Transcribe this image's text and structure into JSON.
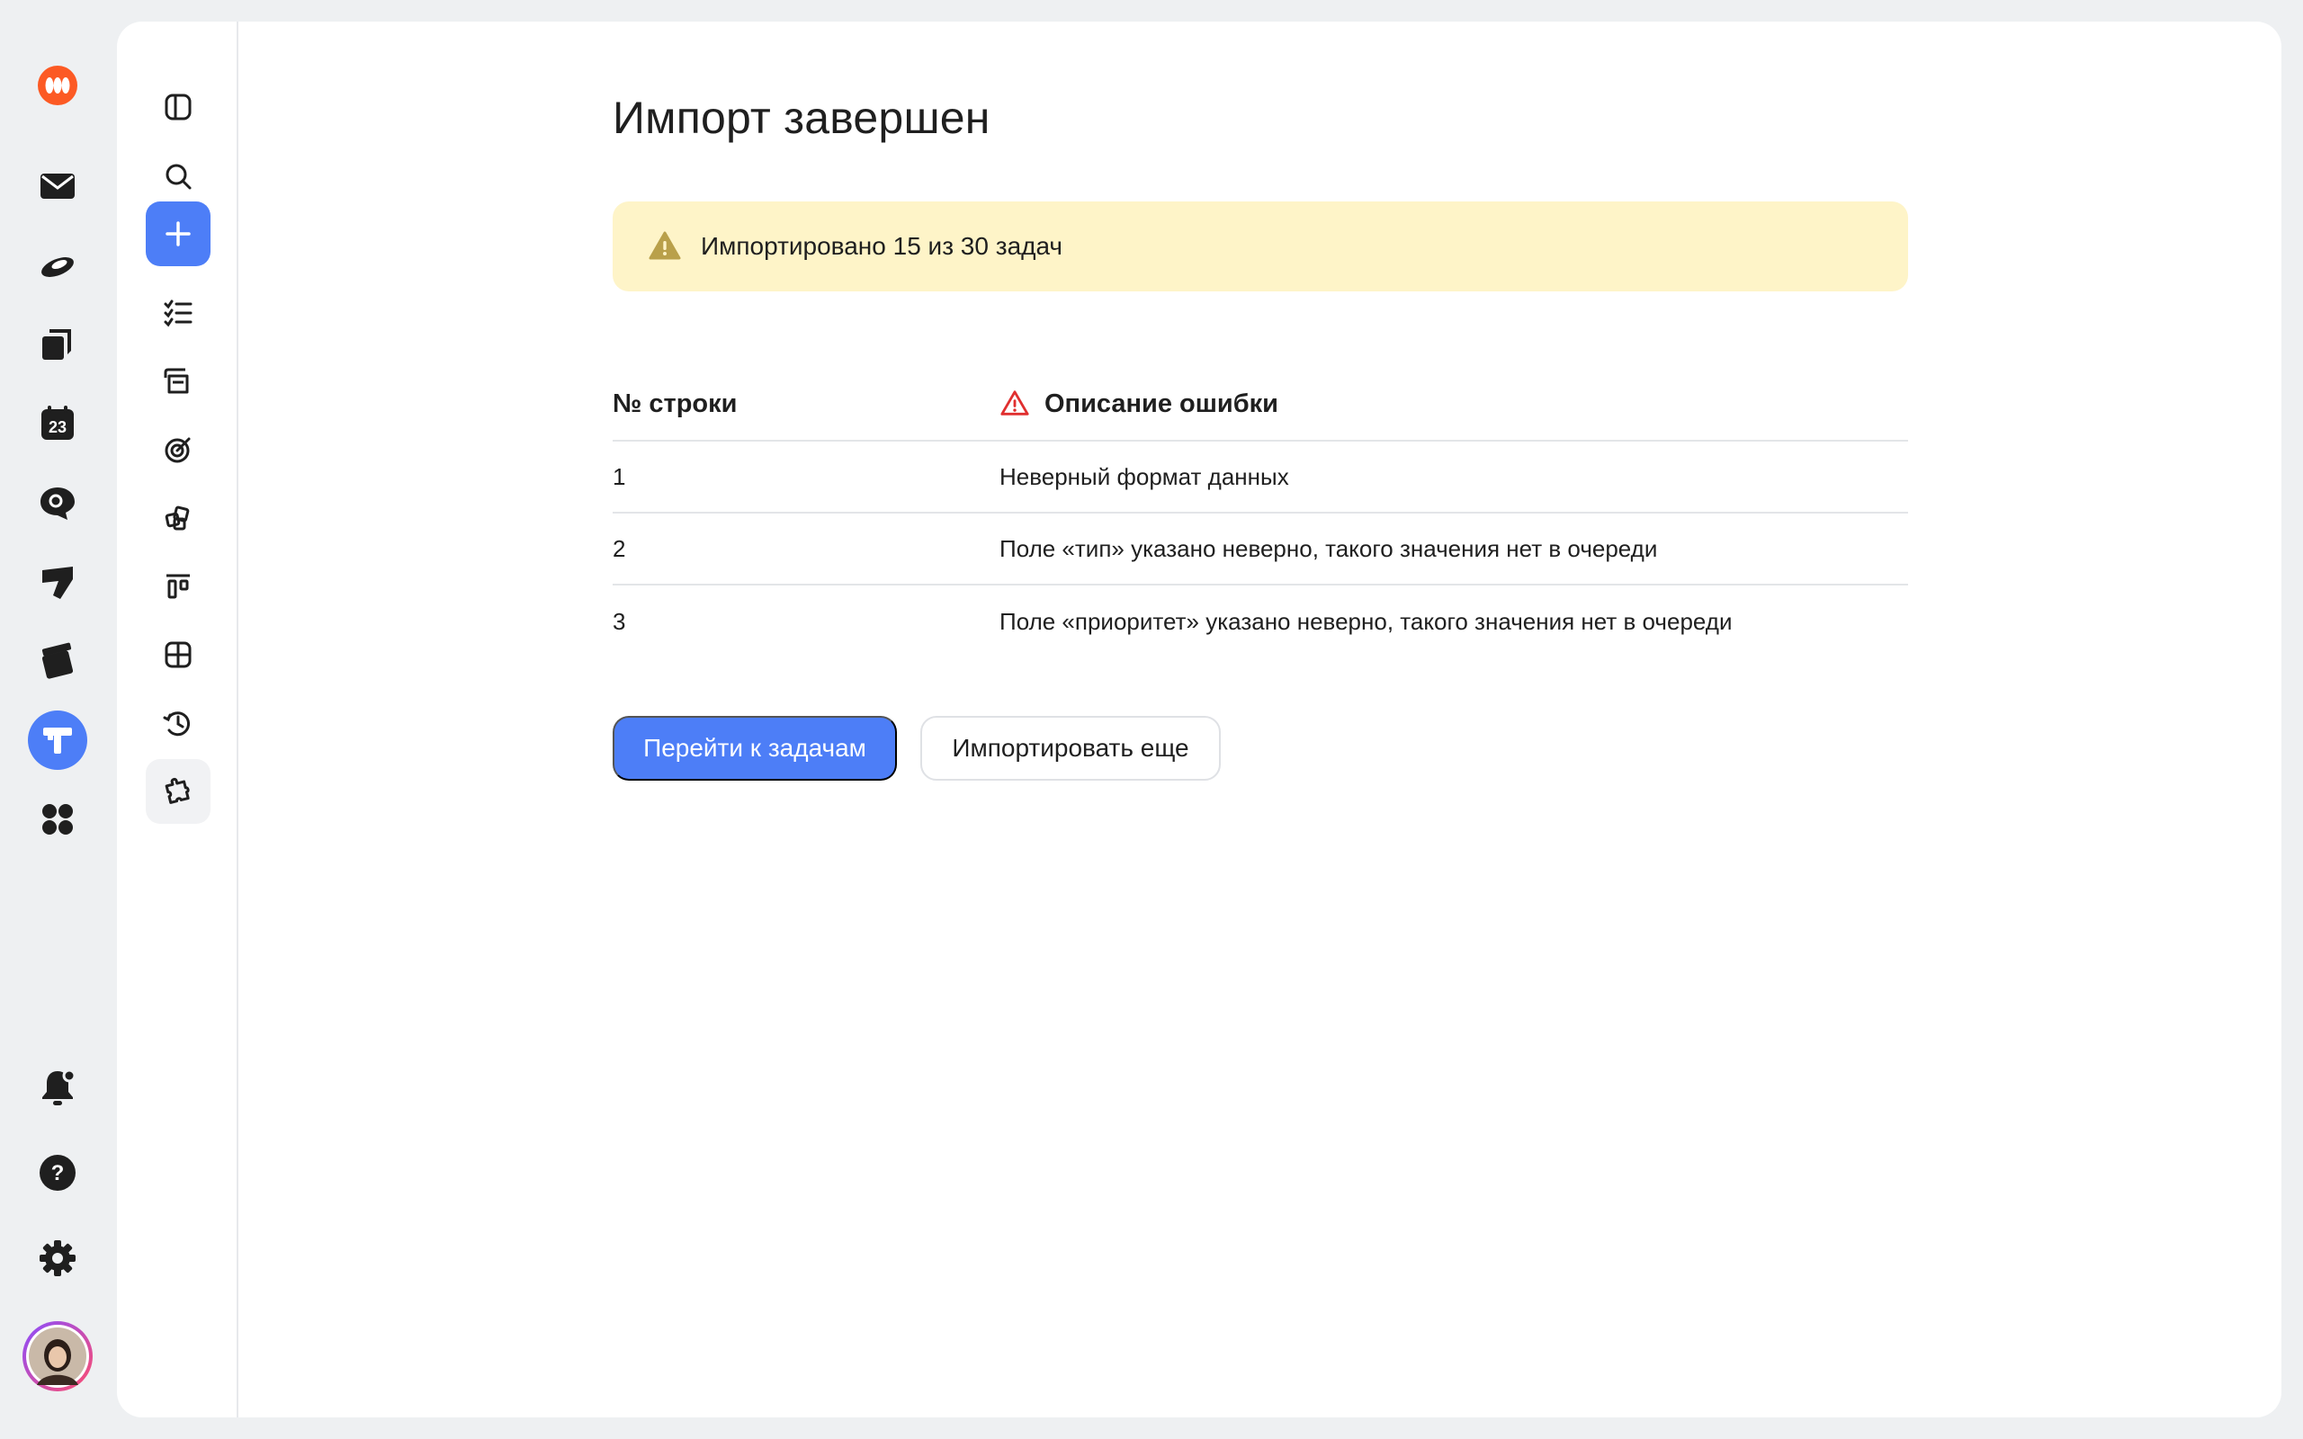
{
  "colors": {
    "accent": "#4d7ef7",
    "banner_bg": "#fef4c8",
    "warning_icon": "#b9a04a",
    "error_icon": "#e02f2f",
    "logo": "#fc5a24"
  },
  "rail": {
    "items": [
      {
        "icon": "app-logo-icon"
      },
      {
        "icon": "mail-icon"
      },
      {
        "icon": "disk-icon"
      },
      {
        "icon": "documents-icon"
      },
      {
        "icon": "calendar-icon",
        "text": "23"
      },
      {
        "icon": "messenger-icon"
      },
      {
        "icon": "forms-icon"
      },
      {
        "icon": "telemost-icon"
      },
      {
        "icon": "tracker-icon",
        "active": true
      },
      {
        "icon": "all-services-icon"
      }
    ],
    "bottom": [
      {
        "icon": "notifications-icon"
      },
      {
        "icon": "help-icon"
      },
      {
        "icon": "settings-icon"
      },
      {
        "icon": "user-avatar"
      }
    ]
  },
  "subnav": {
    "items": [
      {
        "icon": "panel-toggle-icon"
      },
      {
        "icon": "search-icon"
      },
      {
        "icon": "plus-icon"
      },
      {
        "icon": "task-list-icon"
      },
      {
        "icon": "folders-icon"
      },
      {
        "icon": "goals-icon"
      },
      {
        "icon": "components-icon"
      },
      {
        "icon": "boards-icon"
      },
      {
        "icon": "table-icon"
      },
      {
        "icon": "history-icon"
      },
      {
        "icon": "puzzle-icon"
      }
    ]
  },
  "main": {
    "title": "Импорт завершен",
    "banner": "Импортировано 15 из 30 задач",
    "table": {
      "headers": [
        "№ строки",
        "Описание ошибки"
      ],
      "rows": [
        {
          "line": "1",
          "error": "Неверный формат данных"
        },
        {
          "line": "2",
          "error": "Поле «тип» указано неверно, такого значения нет в очереди"
        },
        {
          "line": "3",
          "error": "Поле «приоритет» указано неверно, такого значения нет в очереди"
        }
      ]
    },
    "buttons": {
      "primary": "Перейти к задачам",
      "secondary": "Импортировать еще"
    }
  }
}
